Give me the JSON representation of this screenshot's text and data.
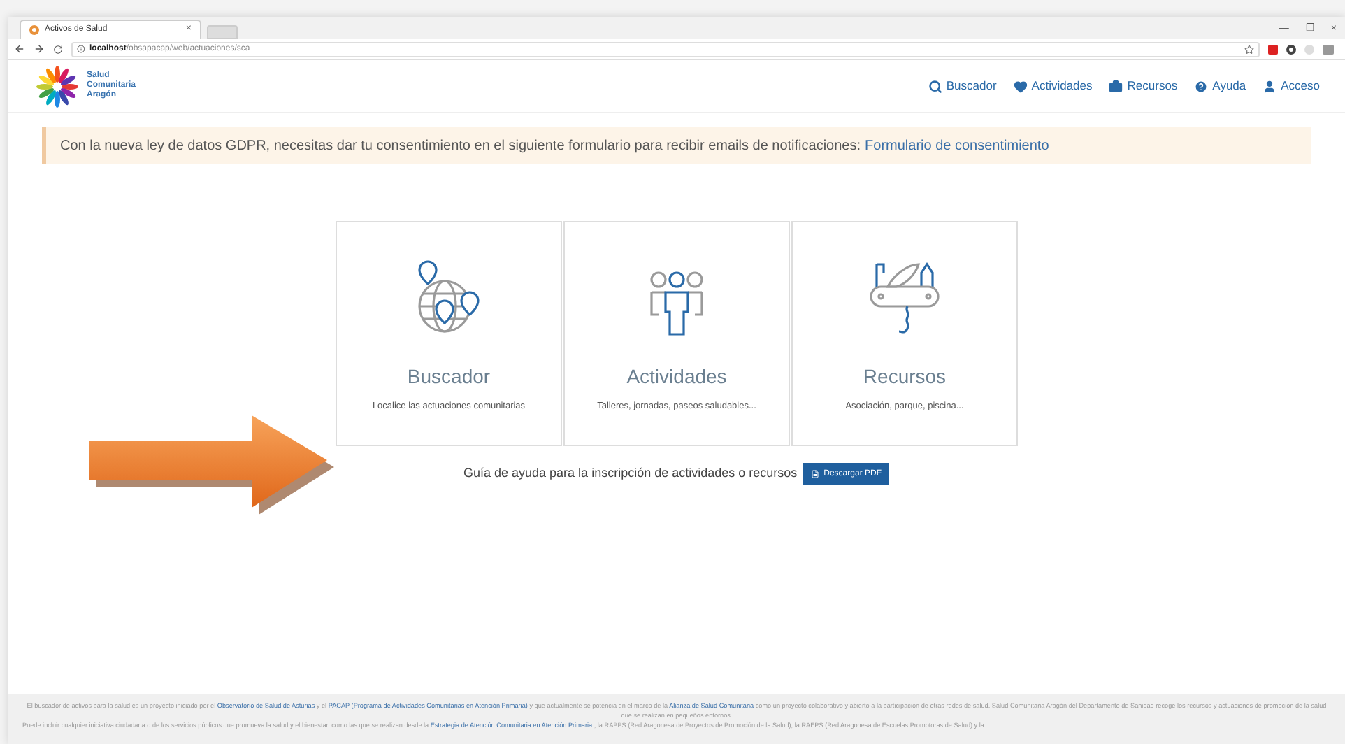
{
  "browser": {
    "tab_title": "Activos de Salud",
    "tab_close": "×",
    "url_host": "localhost",
    "url_path": "/obsapacap/web/actuaciones/sca",
    "window_controls": [
      "—",
      "❐",
      "×"
    ]
  },
  "header": {
    "logo_lines": [
      "Salud",
      "Comunitaria",
      "Aragón"
    ],
    "nav": [
      {
        "kind": "search",
        "label": "Buscador"
      },
      {
        "kind": "heart",
        "label": "Actividades"
      },
      {
        "kind": "briefcase",
        "label": "Recursos"
      },
      {
        "kind": "help",
        "label": "Ayuda"
      },
      {
        "kind": "user",
        "label": "Acceso"
      }
    ]
  },
  "notice": {
    "text": "Con la nueva ley de datos GDPR, necesitas dar tu consentimiento en el siguiente formulario para recibir emails de notificaciones:",
    "link": "Formulario de consentimiento"
  },
  "cards": [
    {
      "kind": "globe",
      "title": "Buscador",
      "subtitle": "Localice las actuaciones comunitarias"
    },
    {
      "kind": "people",
      "title": "Actividades",
      "subtitle": "Talleres, jornadas, paseos saludables..."
    },
    {
      "kind": "knife",
      "title": "Recursos",
      "subtitle": "Asociación, parque, piscina..."
    }
  ],
  "guide": {
    "text": "Guía de ayuda para la inscripción de actividades o recursos",
    "button": "Descargar PDF"
  },
  "footer": [
    [
      {
        "text": "El buscador de activos para la salud es un proyecto iniciado por el",
        "link": false
      },
      {
        "text": "Observatorio de Salud de Asturias",
        "link": true
      },
      {
        "text": "y el",
        "link": false
      },
      {
        "text": "PACAP (Programa de Actividades Comunitarias en Atención Primaria)",
        "link": true
      },
      {
        "text": "y que actualmente se potencia en el marco de la",
        "link": false
      },
      {
        "text": "Alianza de Salud Comunitaria",
        "link": true
      },
      {
        "text": "como un proyecto colaborativo y abierto a la participación de otras redes de salud. Salud Comunitaria Aragón del Departamento de Sanidad recoge los recursos y actuaciones de promoción de la salud que se realizan en pequeños entornos.",
        "link": false
      }
    ],
    [
      {
        "text": "Puede incluir cualquier iniciativa ciudadana o de los servicios públicos que promueva la salud y el bienestar, como las que se realizan desde la",
        "link": false
      },
      {
        "text": "Estrategia de Atención Comunitaria en Atención Primaria",
        "link": true
      },
      {
        "text": ", la RAPPS (Red Aragonesa de Proyectos de Promoción de la Salud), la RAEPS (Red Aragonesa de Escuelas Promotoras de Salud) y la",
        "link": false
      }
    ]
  ]
}
